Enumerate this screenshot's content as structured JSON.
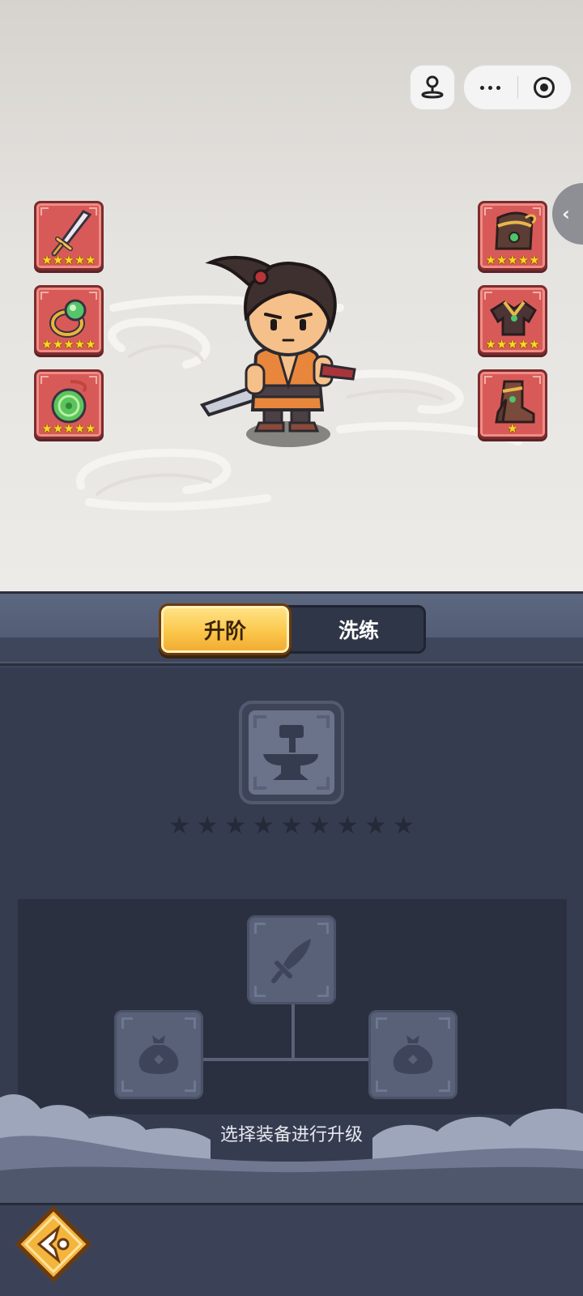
{
  "capsule": {
    "game_icon": "joystick-icon",
    "more_icon": "more-dots-icon",
    "close_icon": "record-circle-icon"
  },
  "side_handle": {
    "icon": "chevron-left-icon",
    "glyph": "‹"
  },
  "equipment": {
    "left": [
      {
        "name": "sword",
        "icon": "sword-icon",
        "stars": 5
      },
      {
        "name": "ring",
        "icon": "jade-ring-icon",
        "stars": 5
      },
      {
        "name": "amulet",
        "icon": "jade-pendant-icon",
        "stars": 5
      }
    ],
    "right": [
      {
        "name": "hat",
        "icon": "hat-icon",
        "stars": 5
      },
      {
        "name": "armor",
        "icon": "armor-icon",
        "stars": 5
      },
      {
        "name": "boots",
        "icon": "boots-icon",
        "stars": 1
      }
    ]
  },
  "hero": {
    "icon": "hero-swordsman-icon"
  },
  "tabs": [
    {
      "label": "升阶",
      "active": true
    },
    {
      "label": "洗练",
      "active": false
    }
  ],
  "upgrade": {
    "anvil_icon": "anvil-hammer-icon",
    "empty_star_count": 9,
    "star_glyph": "★",
    "materials": {
      "top_icon": "sword-placeholder-icon",
      "left_icon": "money-bag-icon",
      "right_icon": "money-bag-icon"
    },
    "hint": "选择装备进行升级"
  },
  "bottom": {
    "back_icon": "back-arrow-icon"
  },
  "colors": {
    "slot_red": "#d85a58",
    "tab_gold": "#fbc74c",
    "panel": "#363c50",
    "star": "#ffd42a"
  }
}
